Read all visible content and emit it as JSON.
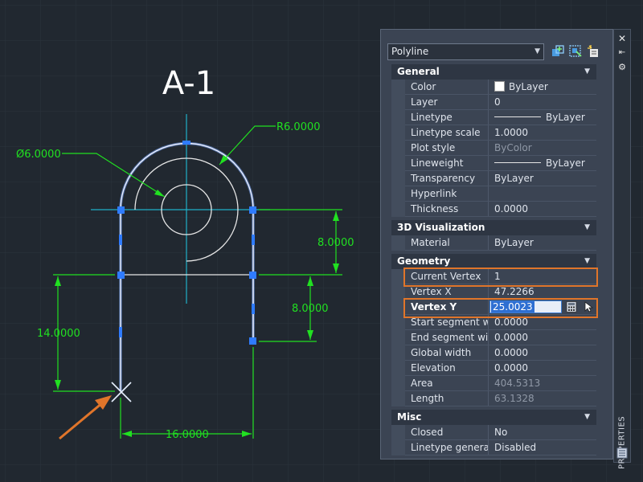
{
  "drawing": {
    "title": "A-1",
    "dimensions": {
      "radius": "R6.0000",
      "diameter": "Ø6.0000",
      "right_upper": "8.0000",
      "right_lower": "8.0000",
      "left_height": "14.0000",
      "bottom_width": "16.0000"
    }
  },
  "colors": {
    "background": "#212830",
    "dimension": "#21e021",
    "centerline": "#1fb0c8",
    "selection": "#4a7fff",
    "highlight": "#e0752a"
  },
  "properties": {
    "object_type": "Polyline",
    "palette_title": "PROPERTIES",
    "sections": {
      "general": "General",
      "viz3d": "3D Visualization",
      "geometry": "Geometry",
      "misc": "Misc"
    },
    "general": [
      {
        "label": "Color",
        "value": "ByLayer"
      },
      {
        "label": "Layer",
        "value": "0"
      },
      {
        "label": "Linetype",
        "value": "ByLayer"
      },
      {
        "label": "Linetype scale",
        "value": "1.0000"
      },
      {
        "label": "Plot style",
        "value": "ByColor"
      },
      {
        "label": "Lineweight",
        "value": "ByLayer"
      },
      {
        "label": "Transparency",
        "value": "ByLayer"
      },
      {
        "label": "Hyperlink",
        "value": ""
      },
      {
        "label": "Thickness",
        "value": "0.0000"
      }
    ],
    "viz3d": [
      {
        "label": "Material",
        "value": "ByLayer"
      }
    ],
    "geometry": [
      {
        "label": "Current Vertex",
        "value": "1"
      },
      {
        "label": "Vertex X",
        "value": "47.2266"
      },
      {
        "label": "Vertex Y",
        "value": "25.0023"
      },
      {
        "label": "Start segment w...",
        "value": "0.0000"
      },
      {
        "label": "End segment wi...",
        "value": "0.0000"
      },
      {
        "label": "Global width",
        "value": "0.0000"
      },
      {
        "label": "Elevation",
        "value": "0.0000"
      },
      {
        "label": "Area",
        "value": "404.5313"
      },
      {
        "label": "Length",
        "value": "63.1328"
      }
    ],
    "misc": [
      {
        "label": "Closed",
        "value": "No"
      },
      {
        "label": "Linetype genera...",
        "value": "Disabled"
      }
    ]
  }
}
